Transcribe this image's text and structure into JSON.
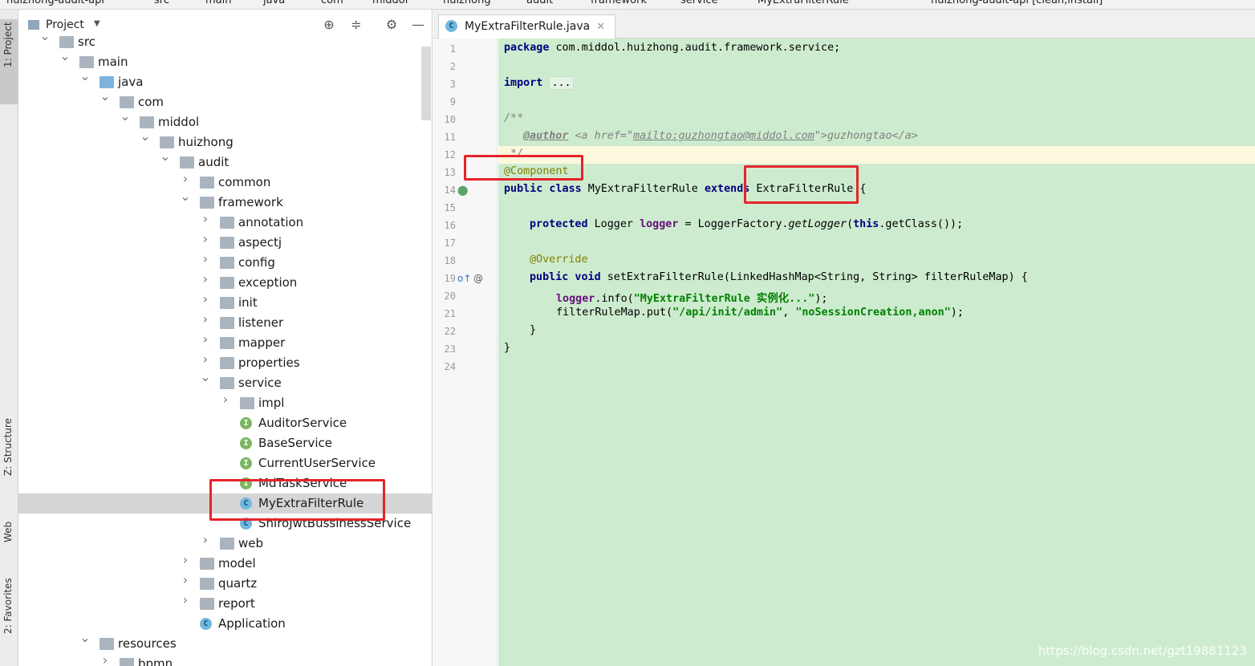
{
  "topbar": {
    "breadcrumbs": [
      "huizhong-audit-api",
      "src",
      "main",
      "java",
      "com",
      "middol",
      "huizhong",
      "audit",
      "framework",
      "service",
      "MyExtraFilterRule"
    ],
    "run_config": "huizhong-audit-api [clean,install]"
  },
  "left_strip": {
    "project_tab": "1: Project",
    "structure_tab": "Z: Structure",
    "web_tab": "Web",
    "favorites_tab": "2: Favorites"
  },
  "project_pane": {
    "title": "Project",
    "tree": [
      {
        "label": "src",
        "depth": 1,
        "kind": "folder",
        "expanded": true
      },
      {
        "label": "main",
        "depth": 2,
        "kind": "folder",
        "expanded": true
      },
      {
        "label": "java",
        "depth": 3,
        "kind": "folder-blue",
        "expanded": true
      },
      {
        "label": "com",
        "depth": 4,
        "kind": "folder",
        "expanded": true
      },
      {
        "label": "middol",
        "depth": 5,
        "kind": "folder",
        "expanded": true
      },
      {
        "label": "huizhong",
        "depth": 6,
        "kind": "folder",
        "expanded": true
      },
      {
        "label": "audit",
        "depth": 7,
        "kind": "folder",
        "expanded": true
      },
      {
        "label": "common",
        "depth": 8,
        "kind": "folder",
        "expanded": false
      },
      {
        "label": "framework",
        "depth": 8,
        "kind": "folder",
        "expanded": true
      },
      {
        "label": "annotation",
        "depth": 9,
        "kind": "folder",
        "expanded": false
      },
      {
        "label": "aspectj",
        "depth": 9,
        "kind": "folder",
        "expanded": false
      },
      {
        "label": "config",
        "depth": 9,
        "kind": "folder",
        "expanded": false
      },
      {
        "label": "exception",
        "depth": 9,
        "kind": "folder",
        "expanded": false
      },
      {
        "label": "init",
        "depth": 9,
        "kind": "folder",
        "expanded": false
      },
      {
        "label": "listener",
        "depth": 9,
        "kind": "folder",
        "expanded": false
      },
      {
        "label": "mapper",
        "depth": 9,
        "kind": "folder",
        "expanded": false
      },
      {
        "label": "properties",
        "depth": 9,
        "kind": "folder",
        "expanded": false
      },
      {
        "label": "service",
        "depth": 9,
        "kind": "folder",
        "expanded": true
      },
      {
        "label": "impl",
        "depth": 10,
        "kind": "folder",
        "expanded": false
      },
      {
        "label": "AuditorService",
        "depth": 10,
        "kind": "interface"
      },
      {
        "label": "BaseService",
        "depth": 10,
        "kind": "interface"
      },
      {
        "label": "CurrentUserService",
        "depth": 10,
        "kind": "interface"
      },
      {
        "label": "MdTaskService",
        "depth": 10,
        "kind": "interface"
      },
      {
        "label": "MyExtraFilterRule",
        "depth": 10,
        "kind": "class",
        "selected": true
      },
      {
        "label": "ShiroJwtBussinessService",
        "depth": 10,
        "kind": "class"
      },
      {
        "label": "web",
        "depth": 9,
        "kind": "folder",
        "expanded": false
      },
      {
        "label": "model",
        "depth": 8,
        "kind": "folder",
        "expanded": false
      },
      {
        "label": "quartz",
        "depth": 8,
        "kind": "folder",
        "expanded": false
      },
      {
        "label": "report",
        "depth": 8,
        "kind": "folder",
        "expanded": false
      },
      {
        "label": "Application",
        "depth": 8,
        "kind": "app-class"
      },
      {
        "label": "resources",
        "depth": 3,
        "kind": "folder",
        "expanded": true
      },
      {
        "label": "bpmn",
        "depth": 4,
        "kind": "folder",
        "expanded": false
      }
    ]
  },
  "editor": {
    "tab_label": "MyExtraFilterRule.java",
    "line_numbers": [
      "1",
      "2",
      "3",
      "9",
      "10",
      "11",
      "12",
      "13",
      "14",
      "15",
      "16",
      "17",
      "18",
      "19",
      "20",
      "21",
      "22",
      "23",
      "24"
    ],
    "code": {
      "l1_kw": "package",
      "l1_rest": " com.middol.huizhong.audit.framework.service;",
      "l3_kw": "import",
      "l3_fold": "...",
      "l10": "/**",
      "l11_tag": "@author",
      "l11_a_open": " <a href=\"",
      "l11_mail": "mailto:guzhongtao@middol.com",
      "l11_a_mid": "\">guzhongtao</a>",
      "l12": " */",
      "l13_ann": "@Component",
      "l14_kw1": "public class",
      "l14_name": " MyExtraFilterRule ",
      "l14_kw2": "extends",
      "l14_super": " ExtraFilterRule {",
      "l16_kw": "protected",
      "l16_type": " Logger ",
      "l16_field": "logger",
      "l16_eq": " = LoggerFactory.",
      "l16_method": "getLogger",
      "l16_open": "(",
      "l16_this": "this",
      "l16_end": ".getClass());",
      "l18_ann": "@Override",
      "l19_kw": "public void",
      "l19_rest": " setExtraFilterRule(LinkedHashMap<String, String> filterRuleMap) {",
      "l20_field": "logger",
      "l20_mid": ".info(",
      "l20_str": "\"MyExtraFilterRule 实例化...\"",
      "l20_end": ");",
      "l21_start": "filterRuleMap.put(",
      "l21_str1": "\"/api/init/admin\"",
      "l21_comma": ", ",
      "l21_str2": "\"noSessionCreation,anon\"",
      "l21_end": ");",
      "l22": "}",
      "l23": "}"
    },
    "watermark": "https://blog.csdn.net/gzt19881123"
  },
  "colors": {
    "code_bg": "#cdeccf",
    "annotation_box": "#e5242a",
    "selection": "#d5d5d5"
  }
}
